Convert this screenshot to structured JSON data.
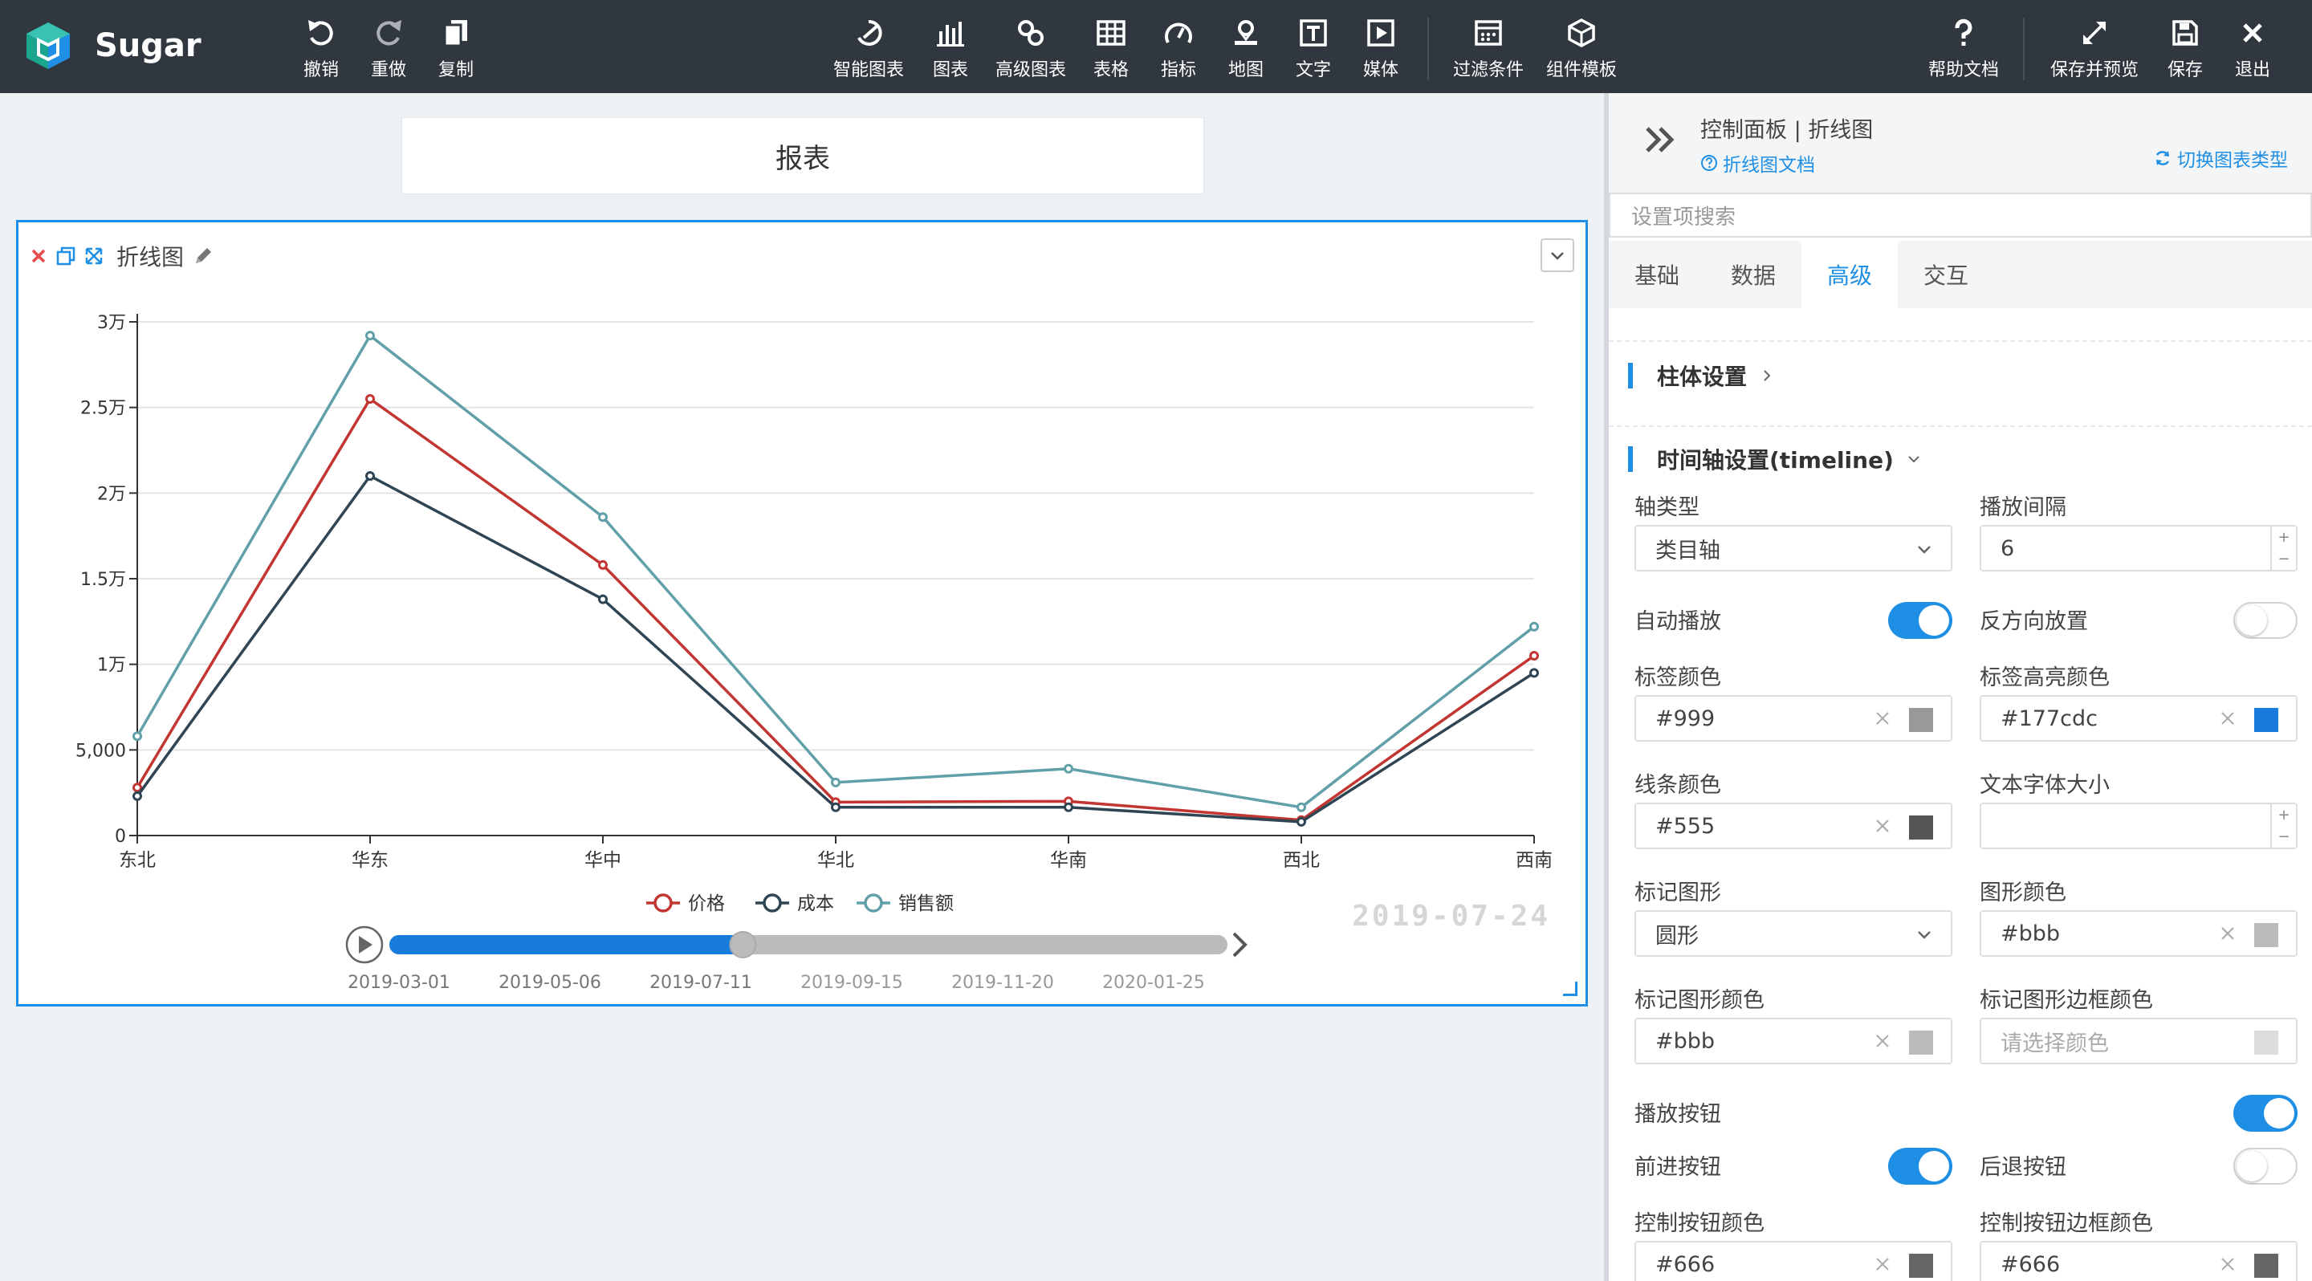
{
  "app": {
    "name": "Sugar"
  },
  "toolbar": {
    "left": [
      {
        "key": "undo",
        "label": "撤销"
      },
      {
        "key": "redo",
        "label": "重做"
      },
      {
        "key": "copy",
        "label": "复制"
      }
    ],
    "center": [
      {
        "key": "smart-chart",
        "label": "智能图表"
      },
      {
        "key": "chart",
        "label": "图表"
      },
      {
        "key": "advanced-chart",
        "label": "高级图表"
      },
      {
        "key": "table",
        "label": "表格"
      },
      {
        "key": "indicator",
        "label": "指标"
      },
      {
        "key": "map",
        "label": "地图"
      },
      {
        "key": "text",
        "label": "文字"
      },
      {
        "key": "media",
        "label": "媒体"
      },
      {
        "key": "filter",
        "label": "过滤条件"
      },
      {
        "key": "component-template",
        "label": "组件模板"
      }
    ],
    "right": [
      {
        "key": "help",
        "label": "帮助文档"
      },
      {
        "key": "save-preview",
        "label": "保存并预览"
      },
      {
        "key": "save",
        "label": "保存"
      },
      {
        "key": "exit",
        "label": "退出"
      }
    ]
  },
  "report": {
    "title": "报表"
  },
  "widget": {
    "title": "折线图"
  },
  "chart_data": {
    "type": "line",
    "categories": [
      "东北",
      "华东",
      "华中",
      "华北",
      "华南",
      "西北",
      "西南"
    ],
    "series": [
      {
        "name": "价格",
        "color": "#c23531",
        "values": [
          2800,
          25500,
          15800,
          1950,
          2000,
          900,
          10500
        ]
      },
      {
        "name": "成本",
        "color": "#2f4554",
        "values": [
          2300,
          21000,
          13800,
          1650,
          1650,
          800,
          9500
        ]
      },
      {
        "name": "销售额",
        "color": "#61a0a8",
        "values": [
          5800,
          29200,
          18600,
          3100,
          3900,
          1650,
          12200
        ]
      }
    ],
    "ylim": [
      0,
      30000
    ],
    "yticks": [
      {
        "v": 0,
        "label": "0"
      },
      {
        "v": 5000,
        "label": "5,000"
      },
      {
        "v": 10000,
        "label": "1万"
      },
      {
        "v": 15000,
        "label": "1.5万"
      },
      {
        "v": 20000,
        "label": "2万"
      },
      {
        "v": 25000,
        "label": "2.5万"
      },
      {
        "v": 30000,
        "label": "3万"
      }
    ],
    "grid": true,
    "legend": "bottom-center",
    "timeline": {
      "dates": [
        "2019-03-01",
        "2019-05-06",
        "2019-07-11",
        "2019-09-15",
        "2019-11-20",
        "2020-01-25"
      ],
      "current": "2019-07-24",
      "progress": 0.42
    }
  },
  "panel": {
    "title": "控制面板 | 折线图",
    "doc_link": "折线图文档",
    "switch_link": "切换图表类型",
    "search_placeholder": "设置项搜索",
    "tabs": [
      "基础",
      "数据",
      "高级",
      "交互"
    ],
    "active_tab": "高级",
    "sections": {
      "bar": "柱体设置",
      "timeline": "时间轴设置(timeline)"
    },
    "fields": {
      "axis_type": {
        "label": "轴类型",
        "value": "类目轴"
      },
      "play_interval": {
        "label": "播放间隔",
        "value": "6"
      },
      "auto_play": {
        "label": "自动播放",
        "on": true
      },
      "inverse": {
        "label": "反方向放置",
        "on": false
      },
      "label_color": {
        "label": "标签颜色",
        "value": "#999",
        "swatch": "#999999"
      },
      "label_highlight_color": {
        "label": "标签高亮颜色",
        "value": "#177cdc",
        "swatch": "#177cdc"
      },
      "line_color": {
        "label": "线条颜色",
        "value": "#555",
        "swatch": "#555555"
      },
      "font_size": {
        "label": "文本字体大小",
        "value": ""
      },
      "symbol": {
        "label": "标记图形",
        "value": "圆形"
      },
      "shape_color": {
        "label": "图形颜色",
        "value": "#bbb",
        "swatch": "#bbbbbb"
      },
      "symbol_color": {
        "label": "标记图形颜色",
        "value": "#bbb",
        "swatch": "#bbbbbb"
      },
      "symbol_border_color": {
        "label": "标记图形边框颜色",
        "placeholder": "请选择颜色",
        "swatch": "#dddddd"
      },
      "play_button": {
        "label": "播放按钮",
        "on": true
      },
      "next_button": {
        "label": "前进按钮",
        "on": true
      },
      "prev_button": {
        "label": "后退按钮",
        "on": false
      },
      "control_color": {
        "label": "控制按钮颜色",
        "value": "#666",
        "swatch": "#666666"
      },
      "control_border_color": {
        "label": "控制按钮边框颜色",
        "value": "#666",
        "swatch": "#666666"
      }
    }
  }
}
